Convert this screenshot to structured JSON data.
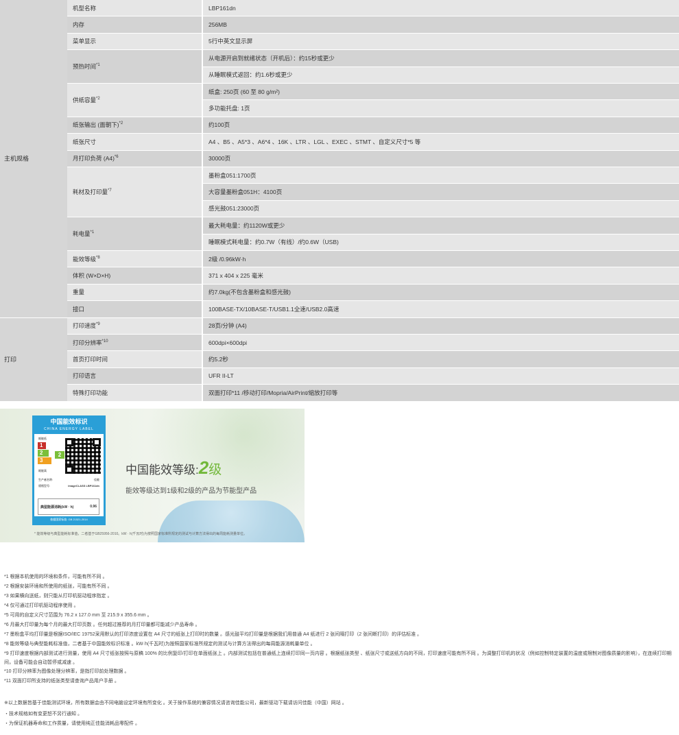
{
  "categories": {
    "main": "主机规格",
    "print": "打印"
  },
  "rows": [
    {
      "label": "机型名称",
      "sup": "",
      "values": [
        "LBP161dn"
      ]
    },
    {
      "label": "内存",
      "sup": "",
      "values": [
        "256MB"
      ]
    },
    {
      "label": "菜单显示",
      "sup": "",
      "values": [
        "5行中英文显示屏"
      ]
    },
    {
      "label": "预热时间",
      "sup": "*1",
      "values": [
        "从电源开启到就绪状态（开机后）：约15秒或更少",
        "从睡眠模式返回：约1.6秒或更少"
      ]
    },
    {
      "label": "供纸容量",
      "sup": "*2",
      "values": [
        "纸盒: 250页 (60 至 80 g/m²)",
        "多功能托盘: 1页"
      ]
    },
    {
      "label": "纸张输出 (面朝下)",
      "sup": "*2",
      "values": [
        "约100页"
      ]
    },
    {
      "label": "纸张尺寸",
      "sup": "",
      "values": [
        "A4 、B5 、A5*3 、A6*4 、16K 、LTR 、LGL 、EXEC 、STMT 、自定义尺寸*5 等"
      ]
    },
    {
      "label": "月打印负荷 (A4)",
      "sup": "*6",
      "values": [
        "30000页"
      ]
    },
    {
      "label": "耗材及打印量",
      "sup": "*7",
      "values": [
        "墨粉盒051:1700页",
        "大容量墨粉盒051H：4100页",
        "感光鼓051:23000页"
      ]
    },
    {
      "label": "耗电量",
      "sup": "*1",
      "values": [
        "最大耗电量：约1120W或更少",
        "睡眠模式耗电量：约0.7W（有线）/约0.6W（USB)"
      ]
    },
    {
      "label": "能效等级",
      "sup": "*8",
      "values": [
        "2级 /0.96kW·h"
      ]
    },
    {
      "label": "体积 (W×D×H)",
      "sup": "",
      "values": [
        "371 x 404 x 225 毫米"
      ]
    },
    {
      "label": "重量",
      "sup": "",
      "values": [
        "约7.0kg(不包含墨粉盒和感光鼓)"
      ]
    },
    {
      "label": "接口",
      "sup": "",
      "values": [
        "100BASE-TX/10BASE-T/USB1.1全速/USB2.0高速"
      ]
    },
    {
      "label": "打印速度",
      "sup": "*9",
      "values": [
        "28页/分钟 (A4)"
      ]
    },
    {
      "label": "打印分辨率",
      "sup": "*10",
      "values": [
        "600dpi×600dpi"
      ]
    },
    {
      "label": "首页打印时间",
      "sup": "",
      "values": [
        "约5.2秒"
      ]
    },
    {
      "label": "打印语言",
      "sup": "",
      "values": [
        "UFR II-LT"
      ]
    },
    {
      "label": "特殊打印功能",
      "sup": "",
      "values": [
        "双面打印*11 /移动打印/Mopria/AirPrint/缩放打印等"
      ]
    }
  ],
  "banner": {
    "label_title_cn": "中国能效标识",
    "label_title_en": "CHINA ENERGY LABEL",
    "label_grade_low": "耗能低",
    "label_grade_high": "耗能高",
    "label_maker": "生产者名称:",
    "label_maker_value": "佳能",
    "label_model": "规格型号:",
    "label_model_value": "imageCLASS LBP161dn",
    "label_typical": "典型能源消耗(kW · h)",
    "label_typical_value": "0.96",
    "label_standard": "依据国家标准: GB 21521-2014",
    "title_prefix": "中国能效等级:",
    "title_num": "2",
    "title_suffix": "级",
    "subtitle": "能效等级达到1级和2级的产品为节能型产品",
    "footnote": "* 能效等级与典型能耗标准值，二者基于GB25956-2010。kW · h(千瓦时)为按照国家标准所规定的测试与计算方法得出的每周能耗测量单位。"
  },
  "notes": [
    "*1 根据本机使用的环境和条件，可能有所不同 。",
    "*2 根据安装环境和所使用的纸张，可能有所不同 。",
    "*3 如果横向送纸，则只能从打印机驱动程序指定 。",
    "*4 仅可通过打印机驱动程序使用 。",
    "*5 可用的自定义尺寸范围为 76.2 x 127.0 mm 至 215.9 x 355.6 mm 。",
    "*6 月最大打印量为每个月的最大打印页数 。任何超过推荐的月打印量都可能减少产品寿命 。",
    "*7 墨粉盒平均打印量是根据ISO/IEC 19752采用默认的打印浓度设置在 A4 尺寸的纸张上打印时的数量 。感光鼓平均打印量是根据我们用普通 A4 纸进行 2 张间隔打印（2 张间断打印）的评估标准 。",
    "*8 能效等级与典型能耗标准值，二者基于中国能效标识标准 。kW·h(千瓦时)为按照国家标准所规定的测试与计算方法得出的每周能源消耗量单位 。",
    "*9 打印速度根据内部测试进行测量，使用 A4 尺寸纸张按照与原稿 100% 的比例复印/打印在单面纸张上 。内部测试包括在普通纸上连续打印同一页内容 。根据纸张类型 、纸张尺寸或送纸方向的不同，打印速度可能有所不同 。为调整打印机的状况（例如控制特定装置的温度或限制对图像质量的影响），在连续打印期间，设备可能会自动暂停或减速 。",
    "*10 打印分辨率为图像处理分辨率，是指打印前处理数据 。",
    "*11 双面打印所支持的纸张类型请查询产品用户手册 。"
  ],
  "notes2": [
    "※以上数据皆基于佳能测试环境，所有数据会由不同电脑设定环境有所变化 。关于操作系统的兼容情况请咨询佳能公司，最新驱动下载请访问佳能（中国）网站 。",
    "・技术规格如有变更恕不另行通知 。",
    "・为保证机器寿命和工作质量，请使用纯正佳能消耗品零配件 。"
  ]
}
